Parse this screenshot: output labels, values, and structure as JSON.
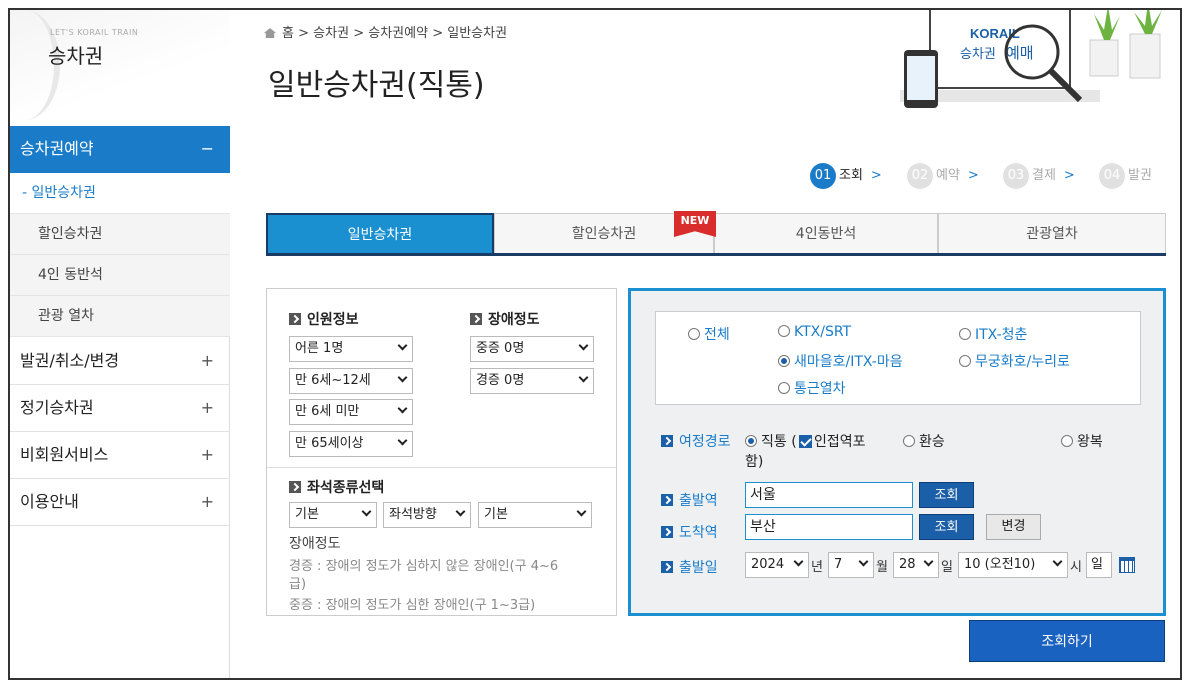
{
  "sidebar": {
    "sub_title": "LET'S KORAIL TRAIN",
    "title": "승차권",
    "menus": [
      {
        "label": "승차권예약",
        "toggle": "−",
        "active": true
      },
      {
        "label": "발권/취소/변경",
        "toggle": "+"
      },
      {
        "label": "정기승차권",
        "toggle": "+"
      },
      {
        "label": "비회원서비스",
        "toggle": "+"
      },
      {
        "label": "이용안내",
        "toggle": "+"
      }
    ],
    "sub_items": [
      {
        "label": "- 일반승차권"
      },
      {
        "label": "할인승차권"
      },
      {
        "label": "4인 동반석"
      },
      {
        "label": "관광 열차"
      }
    ]
  },
  "breadcrumb": {
    "home": "홈",
    "sep": ">",
    "l1": "승차권",
    "l2": "승차권예약",
    "l3": "일반승차권"
  },
  "page_title": "일반승차권(직통)",
  "promo": {
    "brand": "KORAIL",
    "text_a": "승차권",
    "text_b": "예매"
  },
  "steps": [
    {
      "num": "01",
      "label": "조회"
    },
    {
      "num": "02",
      "label": "예약"
    },
    {
      "num": "03",
      "label": "결제"
    },
    {
      "num": "04",
      "label": "발권"
    }
  ],
  "step_arrow": ">",
  "tabs": [
    {
      "label": "일반승차권"
    },
    {
      "label": "할인승차권"
    },
    {
      "label": "4인동반석"
    },
    {
      "label": "관광열차"
    }
  ],
  "new_badge": "NEW",
  "passengers": {
    "title": "인원정보",
    "adult": "어른 1명",
    "child": "만 6세~12세",
    "infant": "만 6세 미만",
    "senior": "만 65세이상"
  },
  "disability": {
    "title": "장애정도",
    "severe": "중증 0명",
    "mild": "경증 0명"
  },
  "seat": {
    "title": "좌석종류선택",
    "type": "기본",
    "direction": "좌석방향",
    "extra": "기본"
  },
  "disability_note": {
    "head": "장애정도",
    "mild_line1": "경증 : 장애의 정도가 심하지 않은 장애인(구 4~6",
    "mild_line2": "급)",
    "severe_line": "중증 : 장애의 정도가 심한 장애인(구 1~3급)"
  },
  "train_types": {
    "all": "전체",
    "ktx": "KTX/SRT",
    "itx_cheongchun": "ITX-청춘",
    "saemaeul": "새마을호/ITX-마음",
    "mugunghwa": "무궁화호/누리로",
    "commuter": "통근열차"
  },
  "route": {
    "label": "여정경로",
    "direct": "직통 (",
    "adjacent": "인접역포",
    "adjacent_cont": "함)",
    "transfer": "환승",
    "round": "왕복"
  },
  "departure": {
    "label": "출발역",
    "value": "서울",
    "btn": "조회"
  },
  "arrival": {
    "label": "도착역",
    "value": "부산",
    "btn": "조회",
    "swap_btn": "변경"
  },
  "date": {
    "label": "출발일",
    "year": "2024",
    "year_unit": "년",
    "month": "7",
    "month_unit": "월",
    "day": "28",
    "day_unit": "일",
    "hour": "10 (오전10)",
    "hour_unit": "시",
    "weekday": "일"
  },
  "search_button": "조회하기",
  "colors": {
    "accent": "#1a90d0",
    "nav_active": "#1a7cc9",
    "button": "#1a5fa8",
    "badge": "#d92d2d"
  }
}
